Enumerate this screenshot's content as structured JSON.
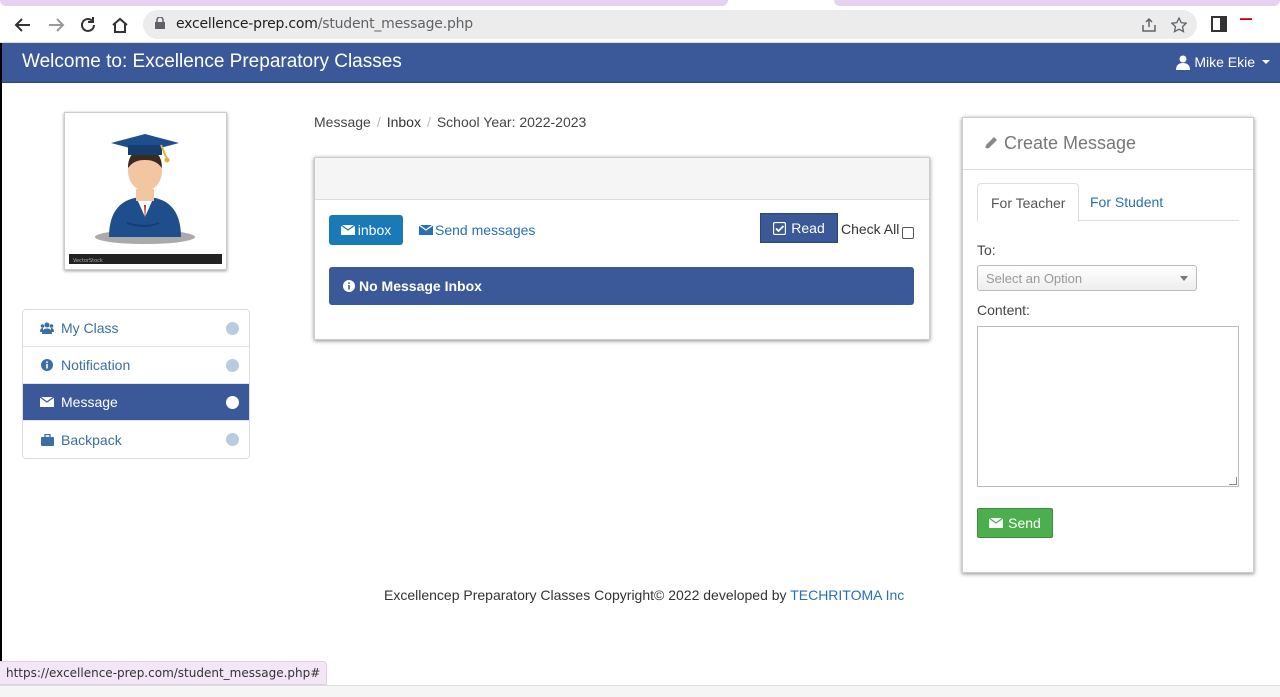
{
  "browser": {
    "url_host": "excellence-prep.com",
    "url_path": "/student_message.php",
    "status_url": "https://excellence-prep.com/student_message.php#"
  },
  "header": {
    "title": "Welcome to: Excellence Preparatory Classes",
    "user_name": "Mike Ekie"
  },
  "sidebar": {
    "items": [
      {
        "label": "My Class",
        "icon": "users-icon"
      },
      {
        "label": "Notification",
        "icon": "info-icon"
      },
      {
        "label": "Message",
        "icon": "envelope-icon",
        "active": true
      },
      {
        "label": "Backpack",
        "icon": "briefcase-icon"
      }
    ]
  },
  "breadcrumb": {
    "items": [
      "Message",
      "Inbox",
      "School Year: 2022-2023"
    ]
  },
  "inbox": {
    "inbox_button": "inbox",
    "send_link": "Send messages",
    "read_button": "Read",
    "check_all": "Check All",
    "empty_message": "No Message Inbox"
  },
  "create_message": {
    "title": "Create Message",
    "tabs": [
      "For Teacher",
      "For Student"
    ],
    "to_label": "To:",
    "select_placeholder": "Select an Option",
    "content_label": "Content:",
    "send_button": "Send"
  },
  "footer": {
    "text": "Excellencep Preparatory Classes Copyright© 2022 developed by",
    "link": "TECHRITOMA Inc"
  },
  "colors": {
    "brand": "#3b5998",
    "link": "#2a6ebb",
    "success": "#4cae4c",
    "primary": "#1a7ab8"
  }
}
